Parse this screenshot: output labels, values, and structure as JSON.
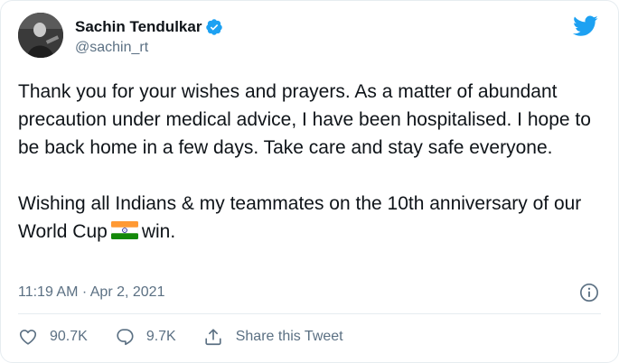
{
  "tweet": {
    "author": {
      "name": "Sachin Tendulkar",
      "handle": "@sachin_rt",
      "verified": true
    },
    "paragraphs": [
      "Thank you for your wishes and prayers. As a matter of abundant precaution under medical advice, I have been hospitalised. I hope to be back home in a few days. Take care and stay safe everyone."
    ],
    "paragraph2_before_flag": "Wishing all Indians & my teammates on the 10th anniversary of our World Cup",
    "paragraph2_after_flag": "win.",
    "timestamp": "11:19 AM · Apr 2, 2021",
    "actions": {
      "likes": "90.7K",
      "replies": "9.7K",
      "share_label": "Share this Tweet"
    }
  },
  "colors": {
    "twitter_blue": "#1da1f2",
    "secondary_text": "#5b7083",
    "flag_saffron": "#ff9933",
    "flag_green": "#138808",
    "flag_chakra": "#000080"
  },
  "icons": [
    "avatar-photo",
    "verified-badge-icon",
    "twitter-bird-icon",
    "india-flag-emoji",
    "info-icon",
    "heart-icon",
    "reply-icon",
    "share-icon"
  ]
}
